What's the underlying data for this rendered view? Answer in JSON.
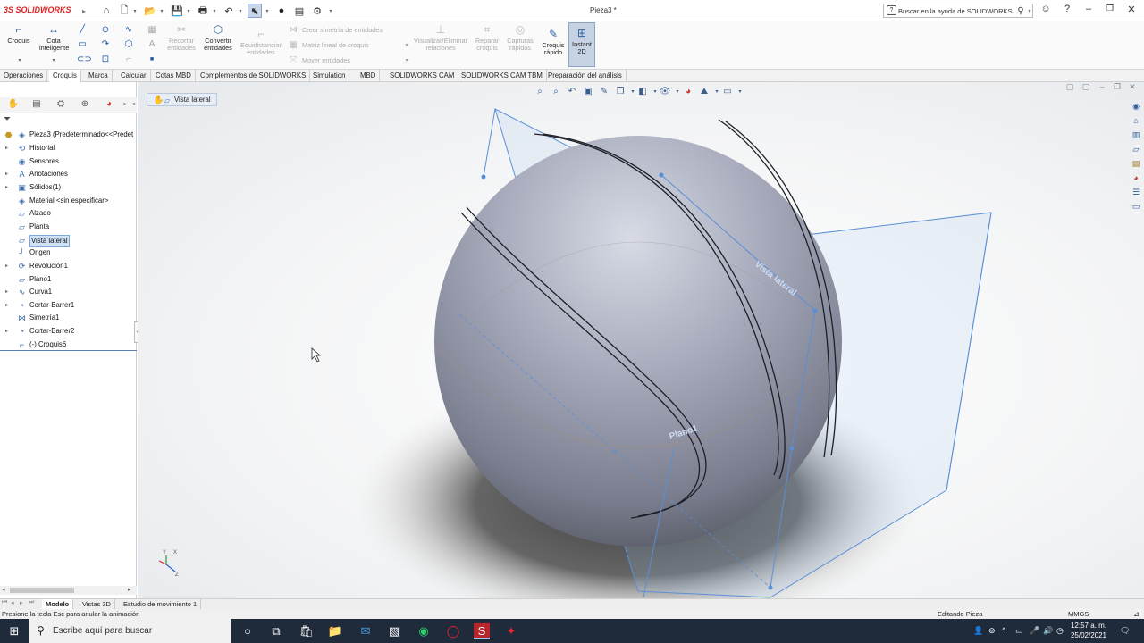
{
  "app": {
    "logo_prefix": "3S",
    "logo_text": "SOLIDWORKS",
    "document_title": "Pieza3 *",
    "help_search_placeholder": "Buscar en la ayuda de SOLIDWORKS"
  },
  "quick_access_icons": [
    "home-icon",
    "new-icon",
    "open-icon",
    "save-icon",
    "print-icon",
    "undo-icon",
    "select-icon",
    "rebuild-icon",
    "file-properties-icon",
    "options-icon"
  ],
  "command_manager": {
    "croquis": "Croquis",
    "cota_inteligente_1": "Cota",
    "cota_inteligente_2": "inteligente",
    "recortar_1": "Recortar",
    "recortar_2": "entidades",
    "convertir_1": "Convertir",
    "convertir_2": "entidades",
    "equidistanciar_1": "Equidistanciar",
    "equidistanciar_2": "entidades",
    "simetria": "Crear simetría de entidades",
    "matriz": "Matriz lineal de croquis",
    "mover": "Mover entidades",
    "visualizar_1": "Visualizar/Eliminar",
    "visualizar_2": "relaciones",
    "reparar_1": "Reparar",
    "reparar_2": "croquis",
    "capturas_1": "Capturas",
    "capturas_2": "rápidas",
    "croquis_rapido_1": "Croquis",
    "croquis_rapido_2": "rápido",
    "instant2d_1": "Instant",
    "instant2d_2": "2D"
  },
  "tabs": [
    "Operaciones",
    "Croquis",
    "Marca",
    "Calcular",
    "Cotas MBD",
    "Complementos de SOLIDWORKS",
    "Simulation",
    "MBD",
    "SOLIDWORKS CAM",
    "SOLIDWORKS CAM TBM",
    "Preparación del análisis"
  ],
  "active_tab": "Croquis",
  "feature_tree": {
    "root": "Pieza3  (Predeterminado<<Predet",
    "items": [
      {
        "label": "Historial",
        "icon": "history-icon",
        "expandable": true
      },
      {
        "label": "Sensores",
        "icon": "sensor-icon",
        "expandable": false
      },
      {
        "label": "Anotaciones",
        "icon": "annotations-icon",
        "expandable": true
      },
      {
        "label": "Sólidos(1)",
        "icon": "solid-bodies-icon",
        "expandable": true
      },
      {
        "label": "Material <sin especificar>",
        "icon": "material-icon",
        "expandable": false
      },
      {
        "label": "Alzado",
        "icon": "plane-icon",
        "expandable": false
      },
      {
        "label": "Planta",
        "icon": "plane-icon",
        "expandable": false
      },
      {
        "label": "Vista lateral",
        "icon": "plane-icon",
        "expandable": false,
        "selected": true
      },
      {
        "label": "Origen",
        "icon": "origin-icon",
        "expandable": false
      },
      {
        "label": "Revolución1",
        "icon": "revolve-icon",
        "expandable": true
      },
      {
        "label": "Plano1",
        "icon": "plane-icon",
        "expandable": false
      },
      {
        "label": "Curva1",
        "icon": "curve-icon",
        "expandable": true
      },
      {
        "label": "Cortar-Barrer1",
        "icon": "cut-sweep-icon",
        "expandable": true
      },
      {
        "label": "Simetría1",
        "icon": "mirror-icon",
        "expandable": false
      },
      {
        "label": "Cortar-Barrer2",
        "icon": "cut-sweep-icon",
        "expandable": true
      },
      {
        "label": "(-) Croquis6",
        "icon": "sketch-icon",
        "expandable": false
      }
    ]
  },
  "graphics": {
    "breadcrumb": "Vista lateral",
    "plane_label_1": "Vista lateral",
    "plane_label_2": "Plano1",
    "triad_x": "X",
    "triad_y": "Y",
    "triad_z": "Z"
  },
  "bottom_tabs": [
    "Modelo",
    "Vistas 3D",
    "Estudio de movimiento 1"
  ],
  "active_bottom_tab": "Modelo",
  "status": {
    "left": "Presione la tecla Esc para anular la animación",
    "mode": "Editando Pieza",
    "units": "MMGS"
  },
  "taskbar": {
    "search_placeholder": "Escribe aquí para buscar",
    "time": "12:57 a. m.",
    "date": "25/02/2021"
  }
}
